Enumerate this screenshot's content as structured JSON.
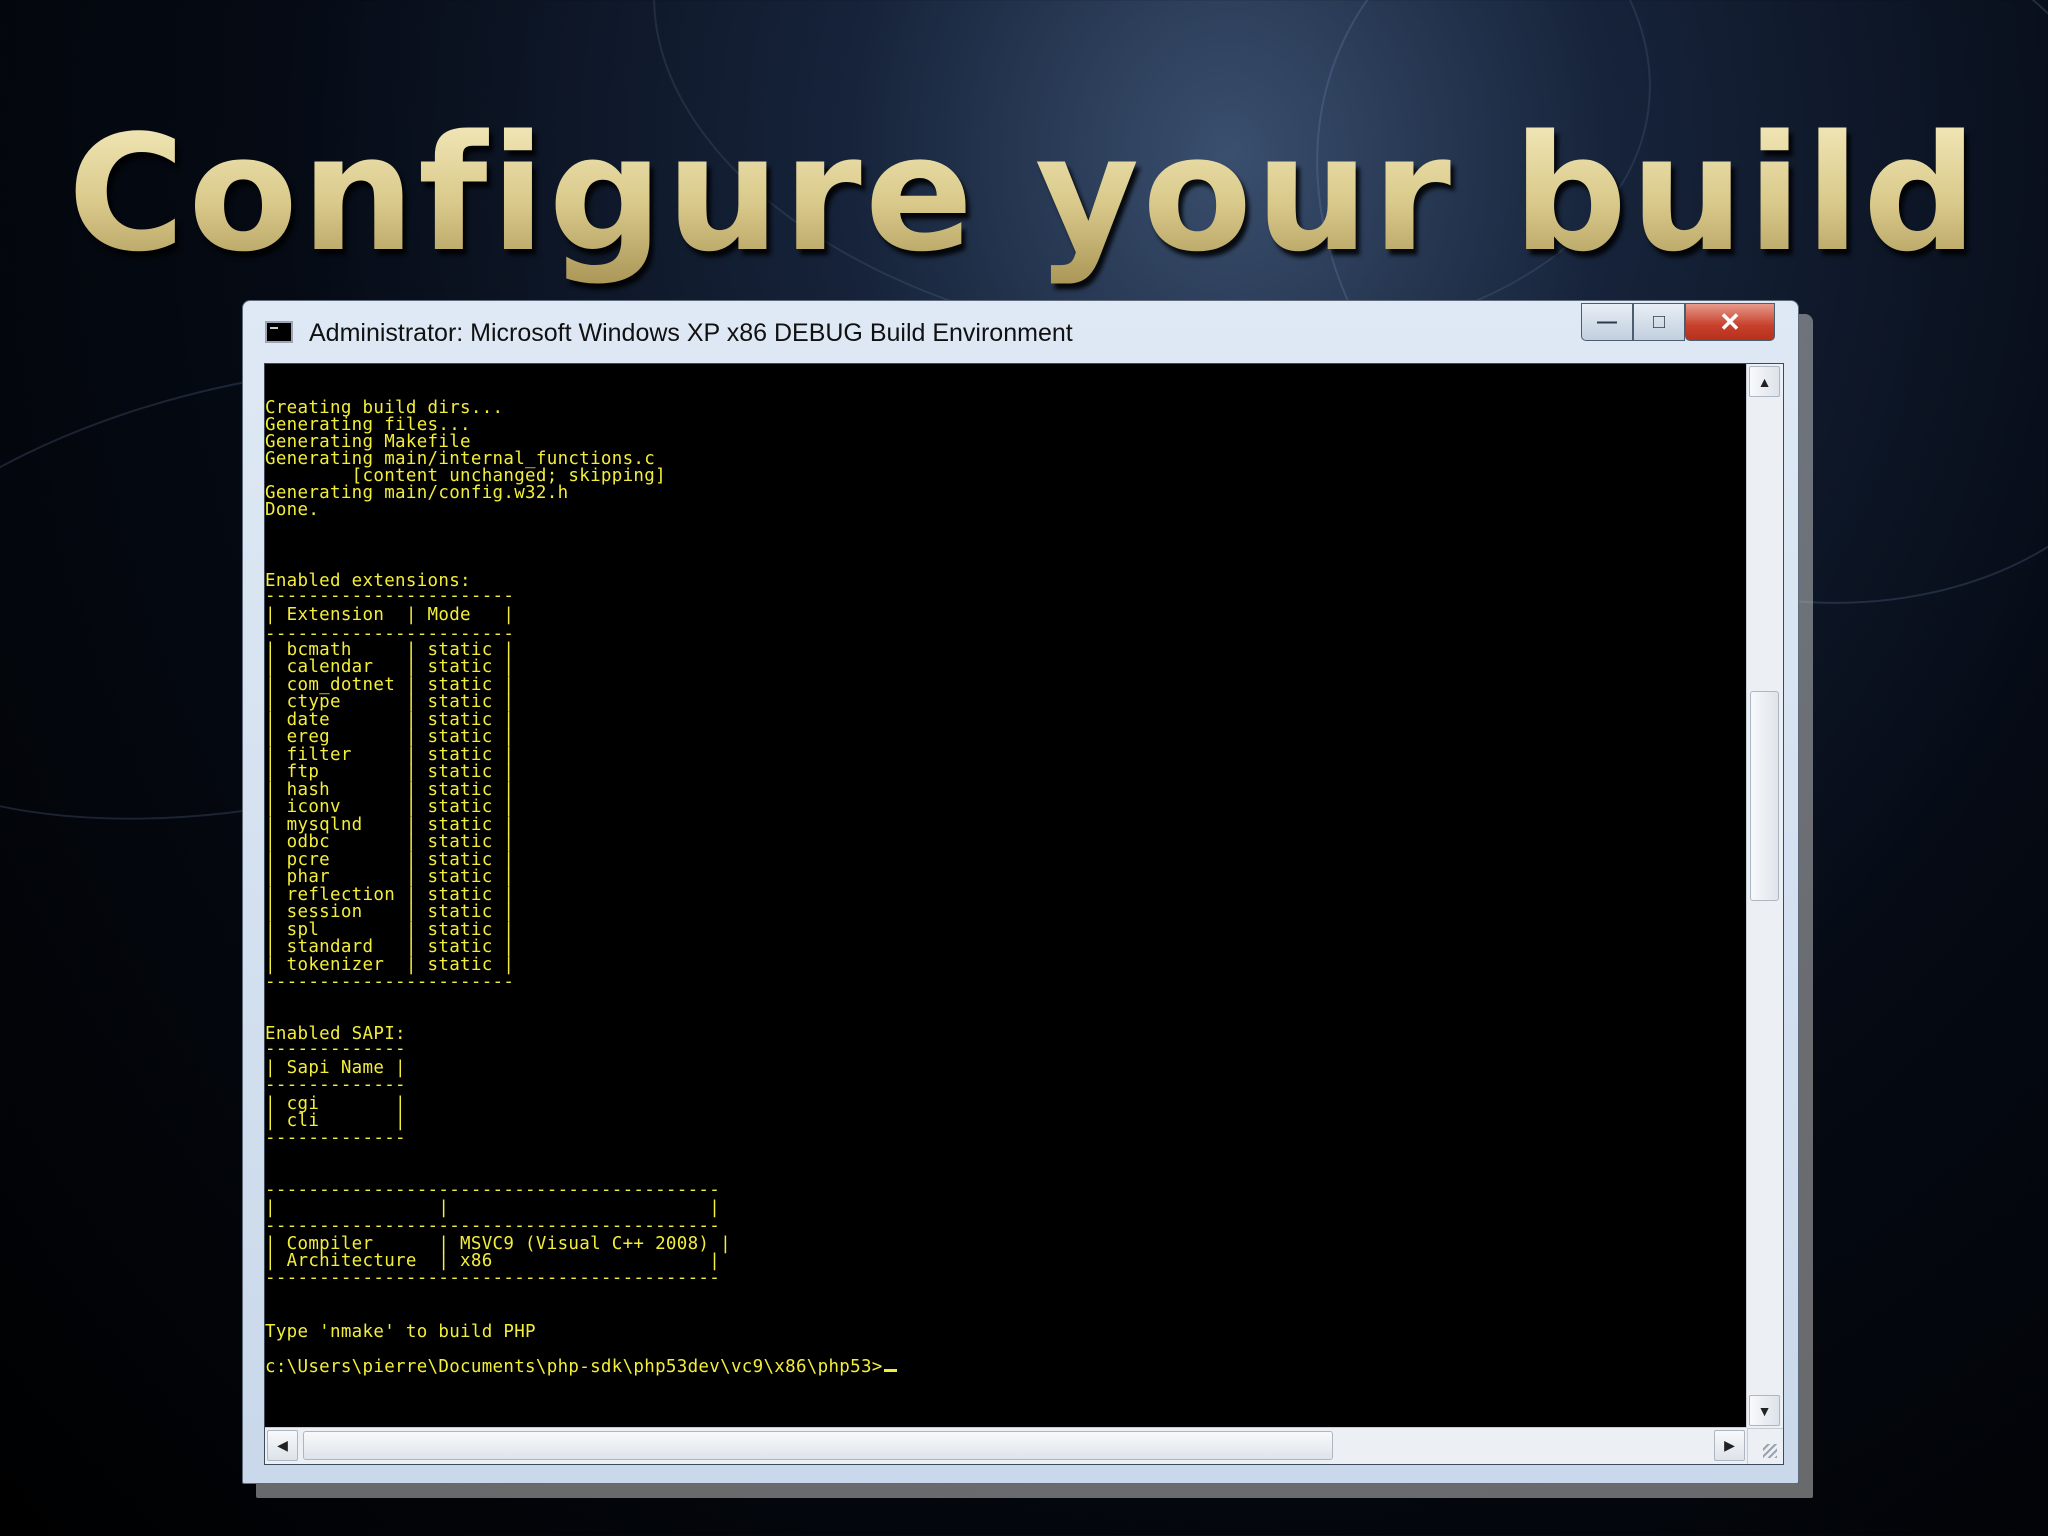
{
  "slide": {
    "title": "Configure your build"
  },
  "window": {
    "title": "Administrator: Microsoft Windows XP x86 DEBUG Build Environment",
    "controls": {
      "minimize": "—",
      "maximize": "□",
      "close": "✕"
    }
  },
  "console": {
    "lines": [
      "Creating build dirs...",
      "Generating files...",
      "Generating Makefile",
      "Generating main/internal_functions.c",
      "        [content unchanged; skipping]",
      "Generating main/config.w32.h",
      "Done.",
      "Enabled extensions:",
      "-----------------------",
      "| Extension  | Mode   |",
      "-----------------------",
      "| bcmath     | static |",
      "| calendar   | static |",
      "| com_dotnet | static |",
      "| ctype      | static |",
      "| date       | static |",
      "| ereg       | static |",
      "| filter     | static |",
      "| ftp        | static |",
      "| hash       | static |",
      "| iconv      | static |",
      "| mysqlnd    | static |",
      "| odbc       | static |",
      "| pcre       | static |",
      "| phar       | static |",
      "| reflection | static |",
      "| session    | static |",
      "| spl        | static |",
      "| standard   | static |",
      "| tokenizer  | static |",
      "-----------------------",
      "Enabled SAPI:",
      "-------------",
      "| Sapi Name |",
      "-------------",
      "| cgi       |",
      "| cli       |",
      "-------------",
      "------------------------------------------",
      "|               |                        |",
      "------------------------------------------",
      "| Compiler      | MSVC9 (Visual C++ 2008) |",
      "| Architecture  | x86                    |",
      "------------------------------------------",
      "Type 'nmake' to build PHP",
      "c:\\Users\\pierre\\Documents\\php-sdk\\php53dev\\vc9\\x86\\php53>"
    ]
  },
  "scrollbars": {
    "up": "▲",
    "down": "▼",
    "left": "◀",
    "right": "▶"
  },
  "colors": {
    "console_text": "#f3ee3a",
    "console_bg": "#000000",
    "title_gold": "#e2d59a"
  }
}
